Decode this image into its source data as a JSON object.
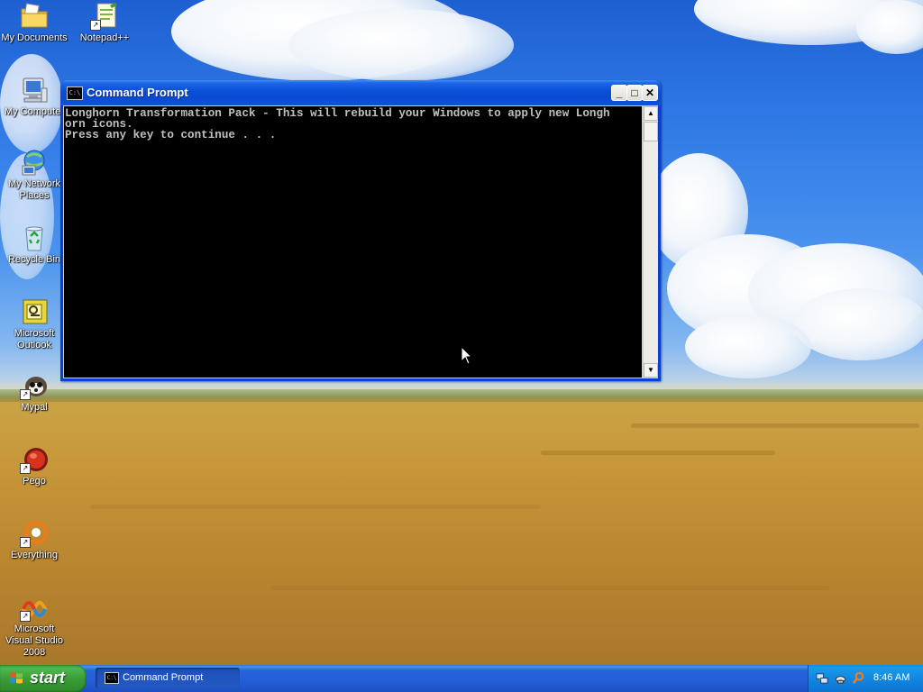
{
  "desktop": {
    "icons": [
      {
        "label": "My Documents",
        "icon": "folder-documents-icon"
      },
      {
        "label": "Notepad++",
        "icon": "notepad-plus-plus-icon"
      },
      {
        "label": "My Computer",
        "icon": "computer-icon"
      },
      {
        "label": "My Network Places",
        "icon": "network-places-icon"
      },
      {
        "label": "Recycle Bin",
        "icon": "recycle-bin-icon"
      },
      {
        "label": "Microsoft Outlook",
        "icon": "outlook-icon"
      },
      {
        "label": "Mypal",
        "icon": "mypal-browser-icon"
      },
      {
        "label": "Pego",
        "icon": "pego-icon"
      },
      {
        "label": "Everything",
        "icon": "everything-search-icon"
      },
      {
        "label": "Microsoft Visual Studio 2008",
        "icon": "visual-studio-icon"
      }
    ],
    "shortcut_arrow": "↗"
  },
  "window": {
    "title": "Command Prompt",
    "icon_text": "C:\\",
    "buttons": {
      "minimize": "_",
      "maximize": "□",
      "close": "✕"
    },
    "console_lines": [
      "Longhorn Transformation Pack - This will rebuild your Windows to apply new Longh",
      "orn icons.",
      "Press any key to continue . . ."
    ],
    "scroll_up": "▲",
    "scroll_down": "▼"
  },
  "taskbar": {
    "start_label": "start",
    "items": [
      {
        "label": "Command Prompt",
        "icon_text": "C:\\"
      }
    ],
    "tray_icons": [
      "network-icon",
      "phone-icon",
      "search-icon"
    ],
    "clock": "8:46 AM"
  },
  "colors": {
    "titlebar": "#0a4fd8",
    "console_bg": "#000000",
    "console_text": "#c0c0c0",
    "start_green": "#3a9a35",
    "taskbar_blue": "#245edb"
  }
}
